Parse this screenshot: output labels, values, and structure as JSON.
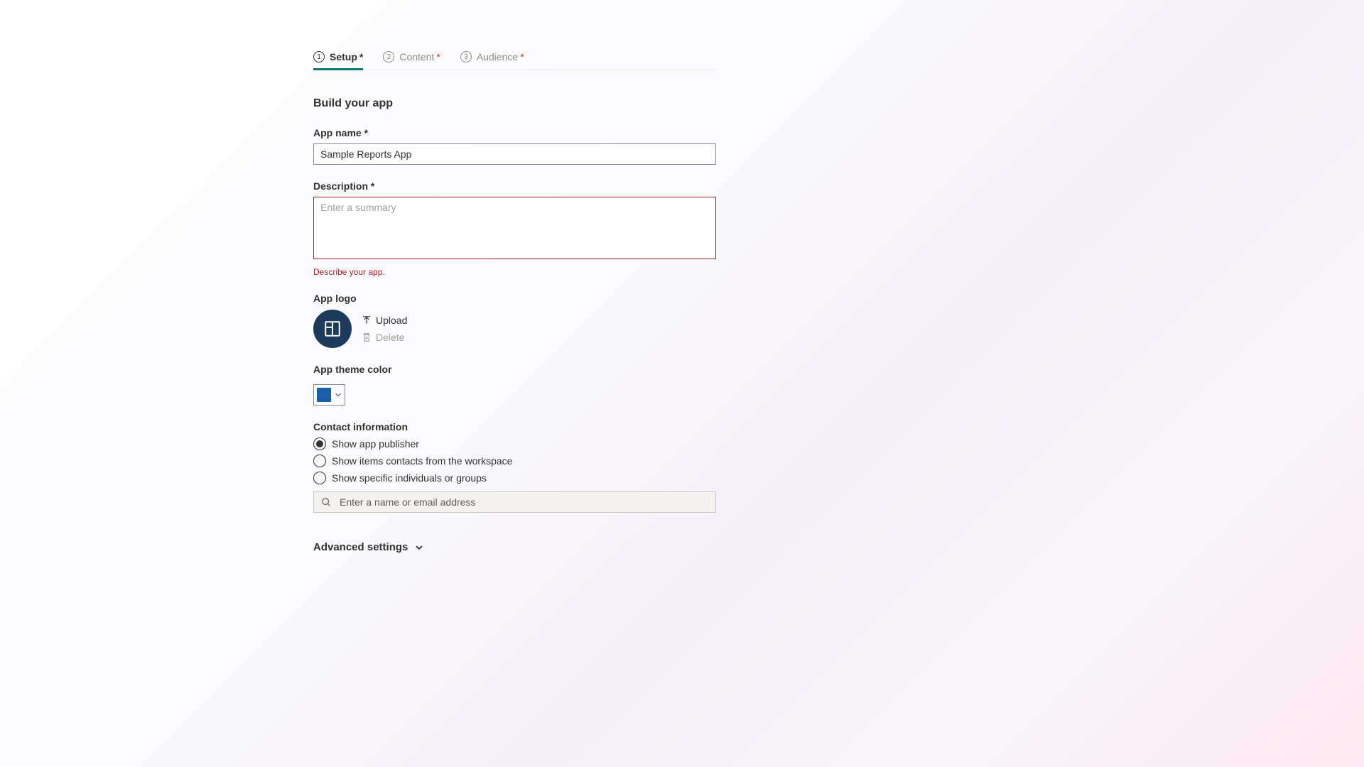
{
  "tabs": [
    {
      "num": "1",
      "label": "Setup",
      "required": true,
      "active": true
    },
    {
      "num": "2",
      "label": "Content",
      "required": true,
      "active": false
    },
    {
      "num": "3",
      "label": "Audience",
      "required": true,
      "active": false
    }
  ],
  "section_title": "Build your app",
  "app_name": {
    "label": "App name *",
    "value": "Sample Reports App"
  },
  "description": {
    "label": "Description *",
    "placeholder": "Enter a summary",
    "error": "Describe your app."
  },
  "app_logo": {
    "label": "App logo",
    "upload_label": "Upload",
    "delete_label": "Delete"
  },
  "theme_color": {
    "label": "App theme color",
    "value": "#1b5fa8"
  },
  "contact": {
    "label": "Contact information",
    "options": [
      {
        "label": "Show app publisher",
        "checked": true
      },
      {
        "label": "Show items contacts from the workspace",
        "checked": false
      },
      {
        "label": "Show specific individuals or groups",
        "checked": false
      }
    ],
    "search_placeholder": "Enter a name or email address"
  },
  "advanced_label": "Advanced settings"
}
